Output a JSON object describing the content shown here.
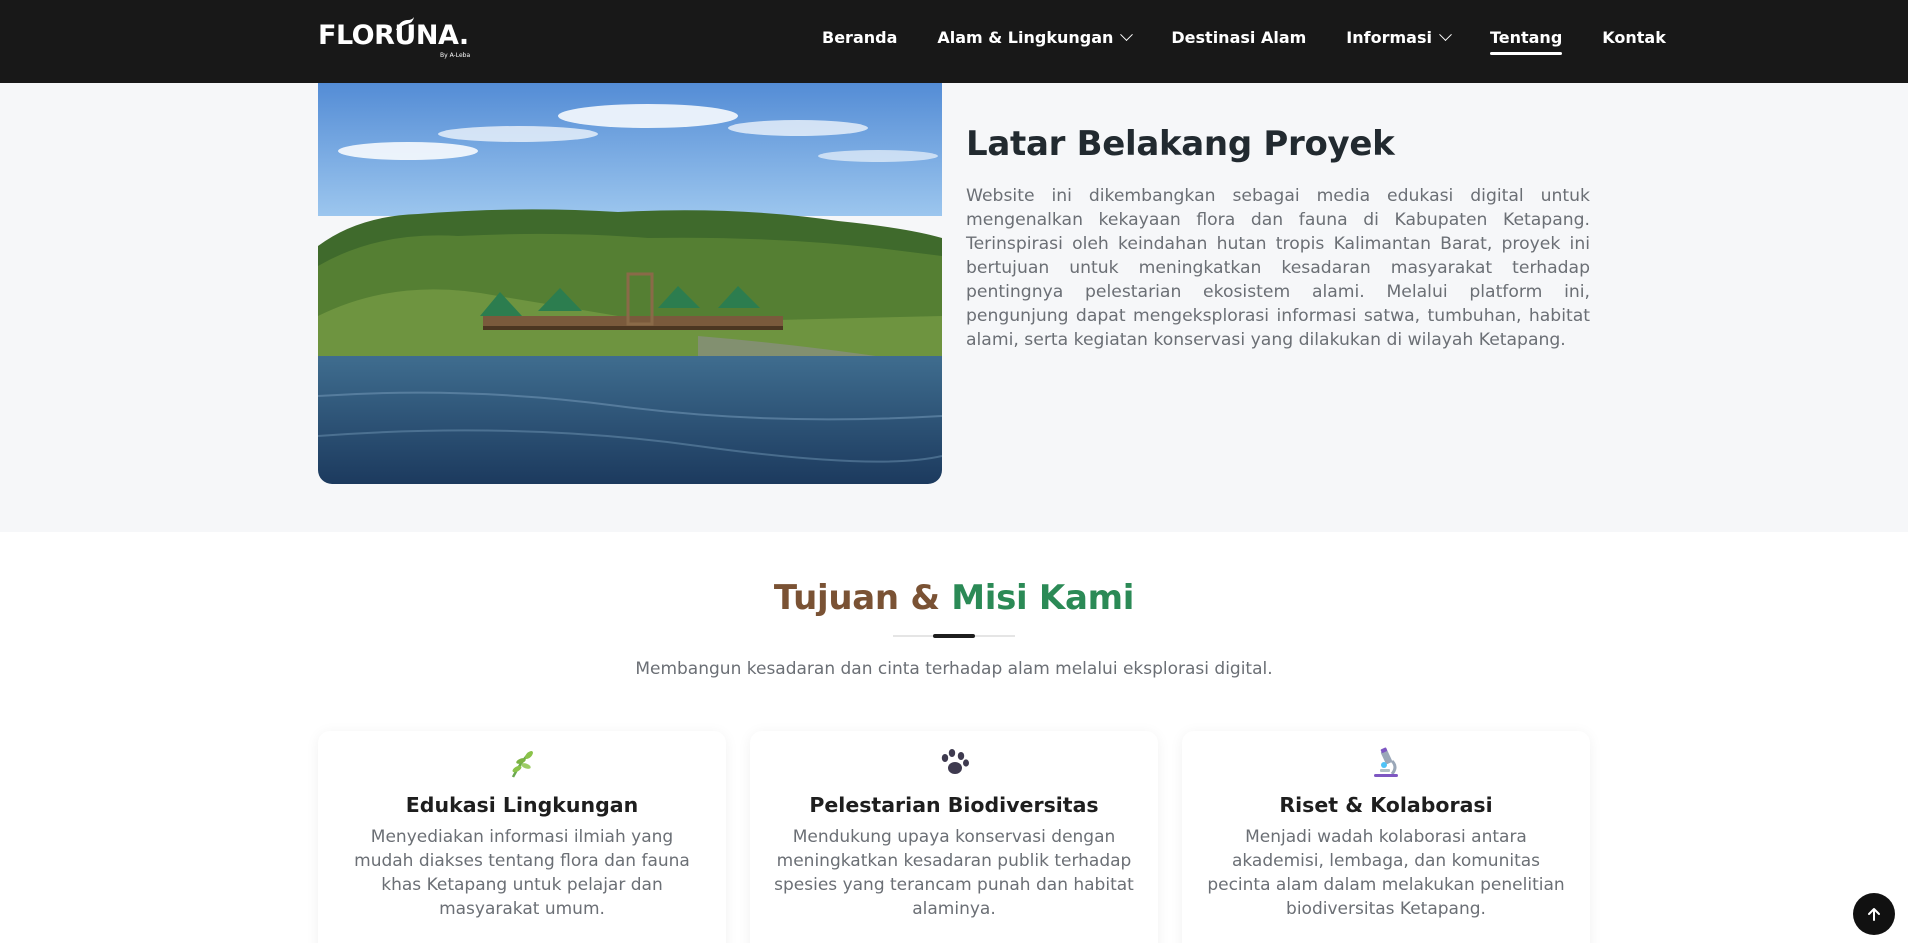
{
  "brand": {
    "name": "FLORUNA.",
    "byline": "By A-Leba"
  },
  "nav": {
    "items": [
      {
        "label": "Beranda",
        "dropdown": false,
        "active": false
      },
      {
        "label": "Alam & Lingkungan",
        "dropdown": true,
        "active": false
      },
      {
        "label": "Destinasi Alam",
        "dropdown": false,
        "active": false
      },
      {
        "label": "Informasi",
        "dropdown": true,
        "active": false
      },
      {
        "label": "Tentang",
        "dropdown": false,
        "active": true
      },
      {
        "label": "Kontak",
        "dropdown": false,
        "active": false
      }
    ]
  },
  "about": {
    "title": "Latar Belakang Proyek",
    "body": "Website ini dikembangkan sebagai media edukasi digital untuk mengenalkan kekayaan flora dan fauna di Kabupaten Ketapang. Terinspirasi oleh keindahan hutan tropis Kalimantan Barat, proyek ini bertujuan untuk meningkatkan kesadaran masyarakat terhadap pentingnya pelestarian ekosistem alami. Melalui platform ini, pengunjung dapat mengeksplorasi informasi satwa, tumbuhan, habitat alami, serta kegiatan konservasi yang dilakukan di wilayah Ketapang."
  },
  "mission": {
    "title_part1": "Tujuan & ",
    "title_part2": "Misi Kami",
    "subtitle": "Membangun kesadaran dan cinta terhadap alam melalui eksplorasi digital.",
    "cards": [
      {
        "icon": "seedling-icon",
        "title": "Edukasi Lingkungan",
        "desc": "Menyediakan informasi ilmiah yang mudah diakses tentang flora dan fauna khas Ketapang untuk pelajar dan masyarakat umum."
      },
      {
        "icon": "paw-icon",
        "title": "Pelestarian Biodiversitas",
        "desc": "Mendukung upaya konservasi dengan meningkatkan kesadaran publik terhadap spesies yang terancam punah dan habitat alaminya."
      },
      {
        "icon": "microscope-icon",
        "title": "Riset & Kolaborasi",
        "desc": "Menjadi wadah kolaborasi antara akademisi, lembaga, dan komunitas pecinta alam dalam melakukan penelitian biodiversitas Ketapang."
      }
    ]
  },
  "colors": {
    "navbar": "#181818",
    "brown": "#7a5234",
    "green": "#2b8a56",
    "band": "#f6f7f9"
  }
}
